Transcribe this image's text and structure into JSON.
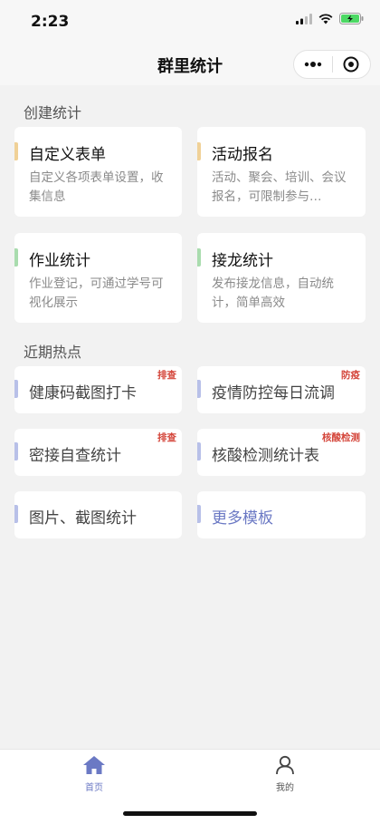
{
  "status": {
    "time": "2:23"
  },
  "nav": {
    "title": "群里统计"
  },
  "sections": {
    "create": "创建统计",
    "hot": "近期热点"
  },
  "create_cards": [
    {
      "title": "自定义表单",
      "desc": "自定义各项表单设置，收集信息",
      "accent": "#f0d197"
    },
    {
      "title": "活动报名",
      "desc": "活动、聚会、培训、会议报名，可限制参与…",
      "accent": "#f0d197"
    },
    {
      "title": "作业统计",
      "desc": "作业登记，可通过学号可视化展示",
      "accent": "#a9dcae"
    },
    {
      "title": "接龙统计",
      "desc": "发布接龙信息，自动统计，简单高效",
      "accent": "#a9dcae"
    }
  ],
  "hot_cards": [
    {
      "title": "健康码截图打卡",
      "tag": "排查"
    },
    {
      "title": "疫情防控每日流调",
      "tag": "防疫"
    },
    {
      "title": "密接自查统计",
      "tag": "排查"
    },
    {
      "title": "核酸检测统计表",
      "tag": "核酸检测"
    },
    {
      "title": "图片、截图统计",
      "tag": ""
    },
    {
      "title": "更多模板",
      "tag": ""
    }
  ],
  "colors": {
    "hot_accent": "#b8c0e8",
    "tag": "#d4453a",
    "tab_active": "#6b79c4",
    "tab_inactive": "#555555"
  },
  "tabs": [
    {
      "label": "首页",
      "icon": "home-icon",
      "active": true
    },
    {
      "label": "我的",
      "icon": "user-icon",
      "active": false
    }
  ]
}
